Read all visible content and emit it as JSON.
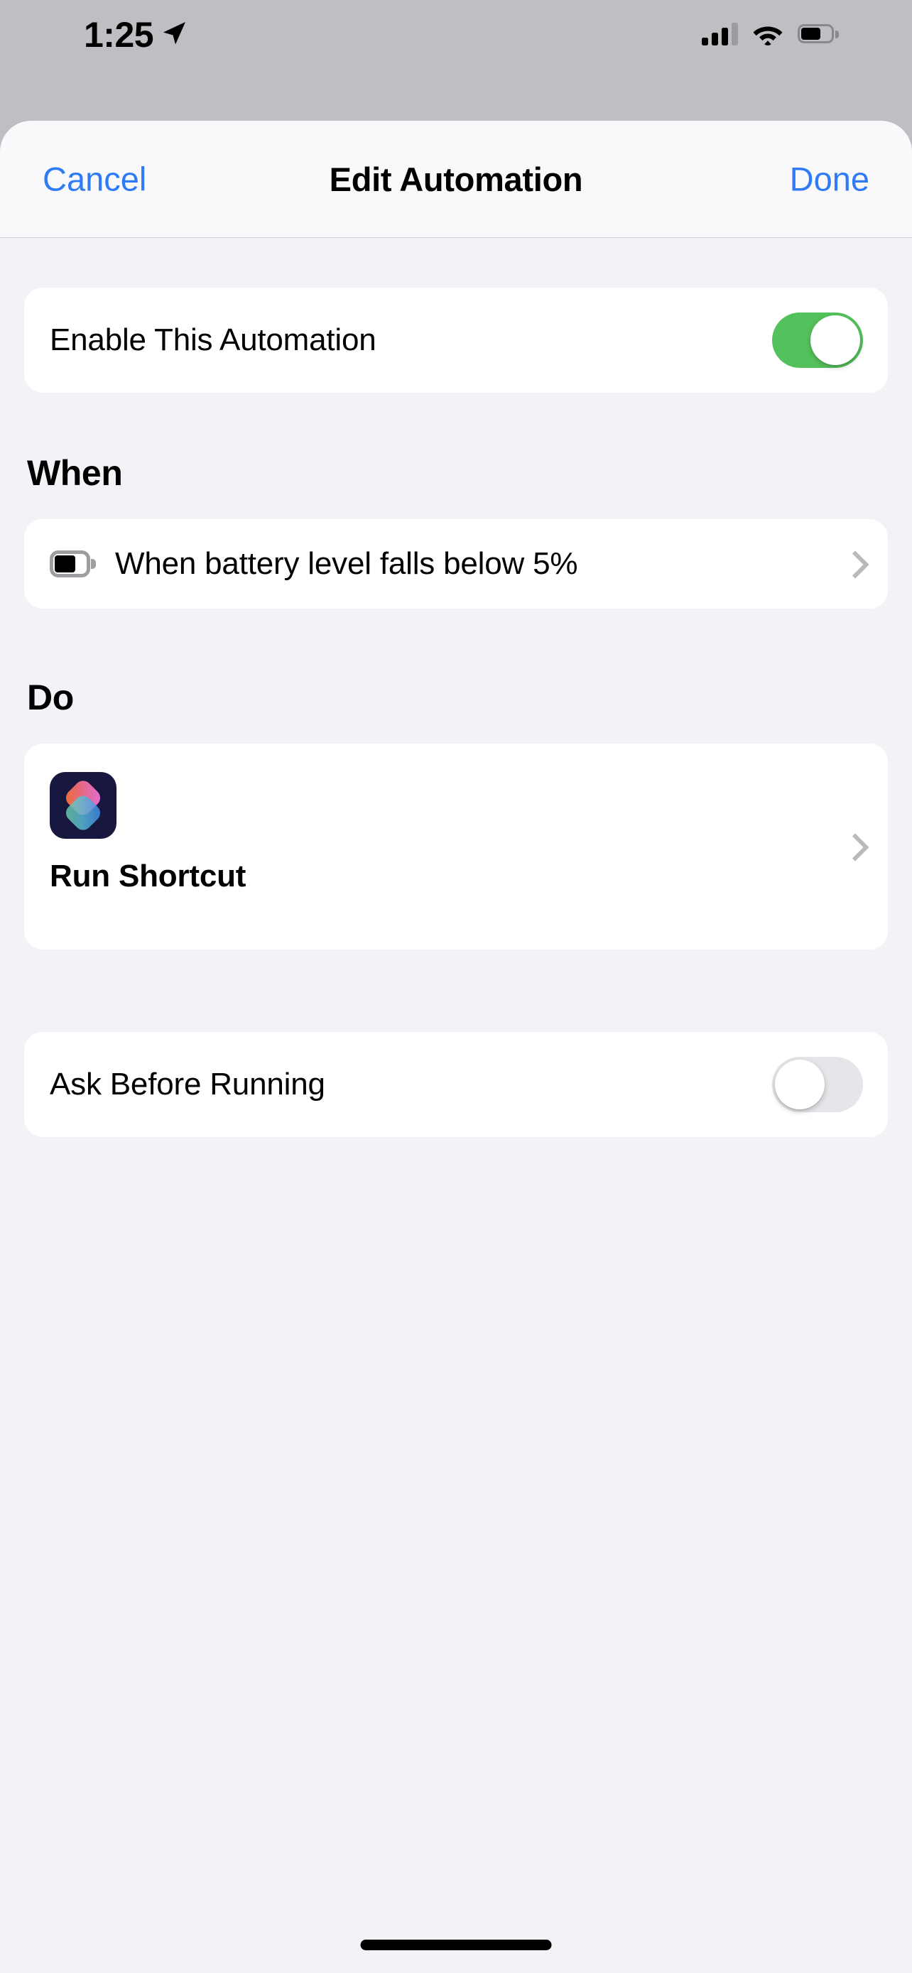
{
  "status_bar": {
    "time": "1:25",
    "location_icon": "location-arrow-icon",
    "cellular_icon": "cellular-signal-icon",
    "cellular_bars_filled": 3,
    "cellular_bars_total": 4,
    "wifi_icon": "wifi-icon",
    "wifi_strength": "full",
    "battery_icon": "battery-icon",
    "battery_level_percent": 60
  },
  "nav_bar": {
    "cancel_label": "Cancel",
    "title": "Edit Automation",
    "done_label": "Done",
    "accent_color": "#2f7bf6"
  },
  "enable_section": {
    "label": "Enable This Automation",
    "toggle_state": "on",
    "toggle_on_color": "#54c25c"
  },
  "when_section": {
    "header": "When",
    "trigger": {
      "icon": "battery-icon",
      "text": "When battery level falls below 5%",
      "chevron_icon": "chevron-right-icon"
    }
  },
  "do_section": {
    "header": "Do",
    "action": {
      "icon": "shortcuts-app-icon",
      "title": "Run Shortcut",
      "chevron_icon": "chevron-right-icon",
      "icon_background_color": "#181740"
    }
  },
  "ask_section": {
    "label": "Ask Before Running",
    "toggle_state": "off",
    "toggle_off_color": "#e6e6ea"
  },
  "home_indicator": {
    "name": "home-indicator"
  }
}
